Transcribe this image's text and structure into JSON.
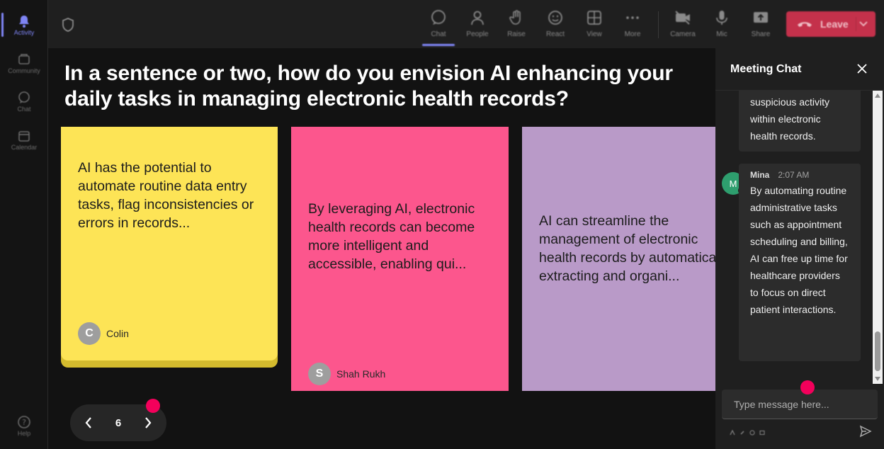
{
  "rail": {
    "items": [
      {
        "label": "Activity",
        "icon": "bell-icon"
      },
      {
        "label": "Community",
        "icon": "community-icon"
      },
      {
        "label": "Chat",
        "icon": "chat-icon"
      },
      {
        "label": "Calendar",
        "icon": "calendar-icon"
      }
    ],
    "help": {
      "label": "Help",
      "icon": "help-icon"
    }
  },
  "toolbar": {
    "chat": "Chat",
    "people": "People",
    "raise": "Raise",
    "react": "React",
    "view": "View",
    "more": "More",
    "camera": "Camera",
    "mic": "Mic",
    "share": "Share",
    "leave": "Leave"
  },
  "stage": {
    "question": "In a sentence or two, how do you envision AI enhancing your daily tasks in managing electronic health records?",
    "cards": [
      {
        "text": "AI has the potential to automate routine data entry tasks, flag inconsistencies or errors in records...",
        "author": "Colin",
        "initial": "C",
        "color": "#fde456"
      },
      {
        "text": "By leveraging AI, electronic health records can become more intelligent and accessible, enabling qui...",
        "author": "Shah Rukh",
        "initial": "S",
        "color": "#fc568d"
      },
      {
        "text": "AI can streamline the management of electronic health records by automatically extracting and organi...",
        "color": "#b99ac8"
      }
    ],
    "page": "6"
  },
  "chat": {
    "title": "Meeting Chat",
    "messages": [
      {
        "text": "suspicious activity within electronic health records."
      },
      {
        "author": "Mina",
        "initial": "M",
        "time": "2:07 AM",
        "text": "By automating routine administrative tasks such as appointment scheduling and billing, AI can free up time for healthcare providers to focus on direct patient interactions."
      }
    ],
    "placeholder": "Type message here..."
  },
  "colors": {
    "accent": "#7f85f5",
    "leave": "#c4314b",
    "notification_dot": "#f3005b"
  }
}
